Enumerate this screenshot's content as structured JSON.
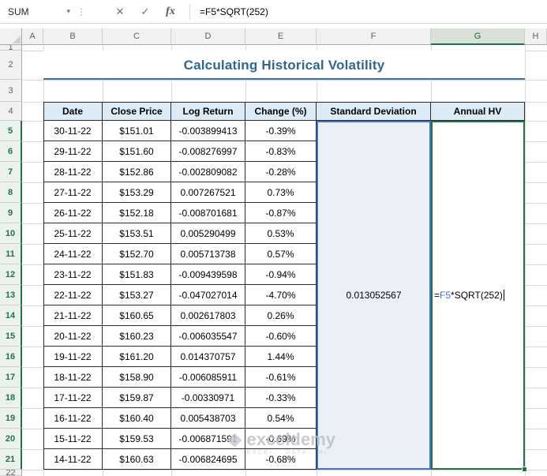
{
  "colors": {
    "selection_green": "#217346",
    "reference_blue": "#4472C4",
    "reference_fill": "#EAEFF8",
    "table_header_fill": "#DDEBF7",
    "title_text": "#31668E",
    "title_rule": "#2E75B6"
  },
  "formula_bar": {
    "name_box": "SUM",
    "cancel": "✕",
    "enter": "✓",
    "fx": "fx",
    "formula": "=F5*SQRT(252)"
  },
  "sheet": {
    "column_headers": [
      "A",
      "B",
      "C",
      "D",
      "E",
      "F",
      "G",
      "H"
    ],
    "selected_column": "G",
    "selected_rows_from": 5,
    "selected_rows_to": 21
  },
  "title": "Calculating Historical Volatility",
  "table": {
    "headers": [
      "Date",
      "Close Price",
      "Log Return",
      "Change (%)",
      "Standard Deviation",
      "Annual HV"
    ],
    "rows": [
      [
        "30-11-22",
        "$151.01",
        "-0.003899413",
        "-0.39%"
      ],
      [
        "29-11-22",
        "$151.60",
        "-0.008276997",
        "-0.83%"
      ],
      [
        "28-11-22",
        "$152.86",
        "-0.002809082",
        "-0.28%"
      ],
      [
        "27-11-22",
        "$153.29",
        "0.007267521",
        "0.73%"
      ],
      [
        "26-11-22",
        "$152.18",
        "-0.008701681",
        "-0.87%"
      ],
      [
        "25-11-22",
        "$153.51",
        "0.005290499",
        "0.53%"
      ],
      [
        "24-11-22",
        "$152.70",
        "0.005713738",
        "0.57%"
      ],
      [
        "23-11-22",
        "$151.83",
        "-0.009439598",
        "-0.94%"
      ],
      [
        "22-11-22",
        "$153.27",
        "-0.047027014",
        "-4.70%"
      ],
      [
        "21-11-22",
        "$160.65",
        "0.002617803",
        "0.26%"
      ],
      [
        "20-11-22",
        "$160.23",
        "-0.006035547",
        "-0.60%"
      ],
      [
        "19-11-22",
        "$161.20",
        "0.014370757",
        "1.44%"
      ],
      [
        "18-11-22",
        "$158.90",
        "-0.006085911",
        "-0.61%"
      ],
      [
        "17-11-22",
        "$159.87",
        "-0.00330971",
        "-0.33%"
      ],
      [
        "16-11-22",
        "$160.40",
        "0.005438703",
        "0.54%"
      ],
      [
        "15-11-22",
        "$159.53",
        "-0.006871591",
        "-0.69%"
      ],
      [
        "14-11-22",
        "$160.63",
        "-0.006824695",
        "-0.68%"
      ]
    ],
    "standard_deviation": "0.013052567",
    "annual_hv_formula": {
      "eq": "=",
      "ref": "F5",
      "rest": "*SQRT(252)"
    }
  },
  "watermark": {
    "brand": "exceldemy",
    "tagline": "EXCEL · DATA · BI"
  }
}
